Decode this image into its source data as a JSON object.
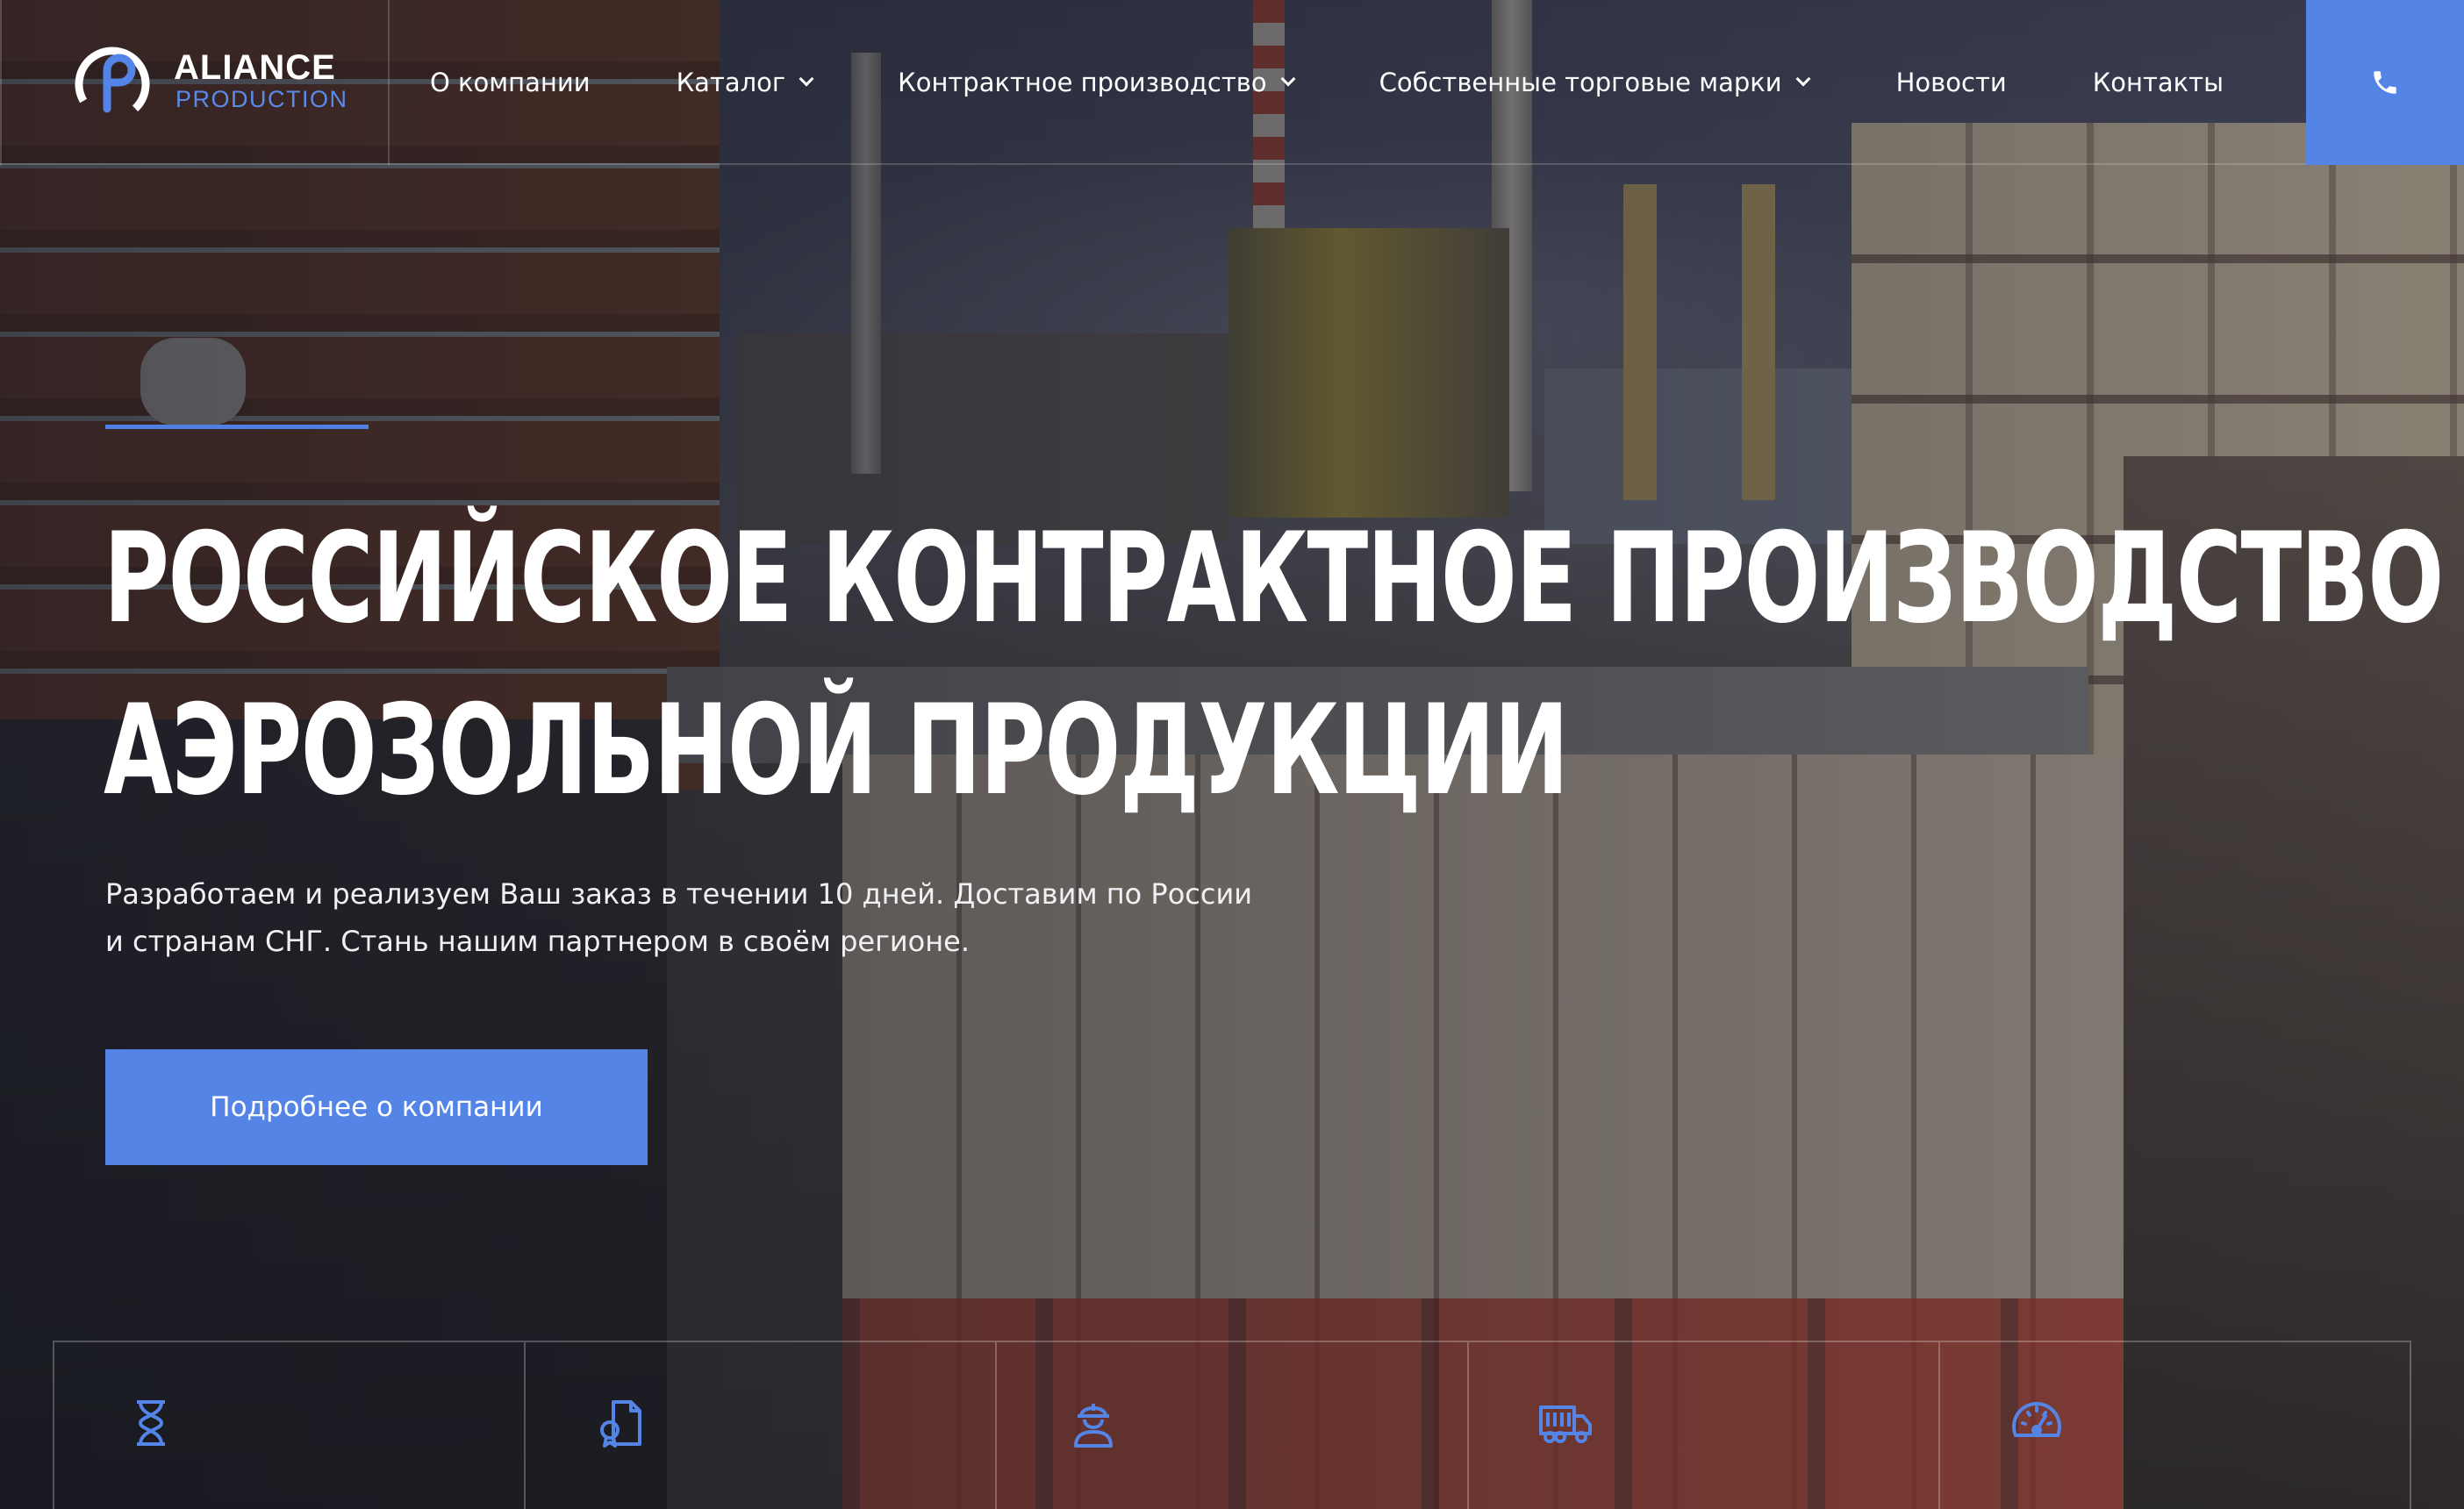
{
  "brand": {
    "name": "ALIANCE",
    "sub": "PRODUCTION",
    "accent": "#5384e6"
  },
  "nav": {
    "items": [
      {
        "label": "О компании",
        "dropdown": false
      },
      {
        "label": "Каталог",
        "dropdown": true
      },
      {
        "label": "Контрактное производство",
        "dropdown": true
      },
      {
        "label": "Собственные торговые марки",
        "dropdown": true
      },
      {
        "label": "Новости",
        "dropdown": false
      },
      {
        "label": "Контакты",
        "dropdown": false
      }
    ],
    "phone_icon": "phone-icon"
  },
  "hero": {
    "title_line1": "Российское контрактное производство",
    "title_line2": "аэрозольной продукции",
    "description": "Разработаем и реализуем Ваш заказ в течении 10 дней. Доставим по России и странам СНГ. Стань нашим партнером в своём регионе.",
    "button": "Подробнее о компании"
  },
  "features": [
    {
      "icon": "hourglass-icon"
    },
    {
      "icon": "document-icon"
    },
    {
      "icon": "worker-icon"
    },
    {
      "icon": "truck-icon"
    },
    {
      "icon": "speedometer-icon"
    }
  ]
}
